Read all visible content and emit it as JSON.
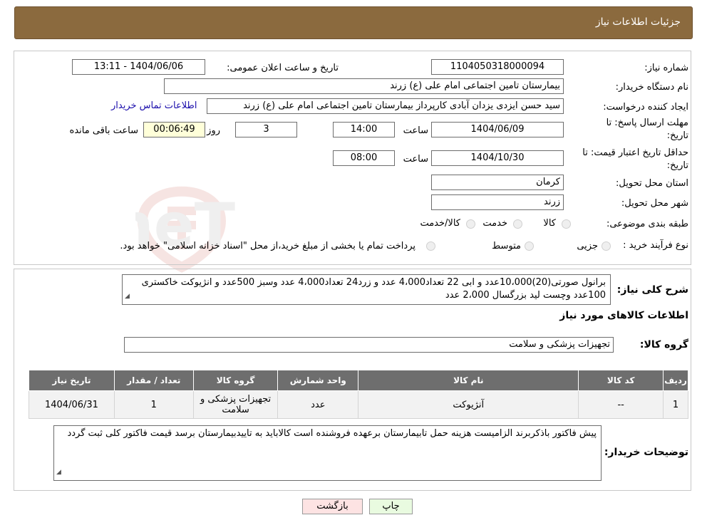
{
  "header": {
    "title": "جزئیات اطلاعات نیاز"
  },
  "form": {
    "need_number": {
      "label": "شماره نیاز:",
      "value": "1104050318000094"
    },
    "announce": {
      "label": "تاریخ و ساعت اعلان عمومی:",
      "value": "1404/06/06 - 13:11"
    },
    "buyer_org": {
      "label": "نام دستگاه خریدار:",
      "value": "بیمارستان تامین اجتماعی امام علی (ع) زرند"
    },
    "requester": {
      "label": "ایجاد کننده درخواست:",
      "value": "سید حسن ایزدی یزدان آبادی کارپرداز بیمارستان تامین اجتماعی امام علی (ع) زرند"
    },
    "buyer_contact_link": "اطلاعات تماس خریدار",
    "deadline": {
      "label_line1": "مهلت ارسال پاسخ: تا",
      "label_line2": "تاریخ:",
      "date": "1404/06/09",
      "time_label": "ساعت",
      "time": "14:00",
      "days": "3",
      "days_label": "روز و",
      "remaining": "00:06:49",
      "remaining_label": "ساعت باقی مانده"
    },
    "price_validity": {
      "label_line1": "حداقل تاریخ اعتبار قیمت: تا",
      "label_line2": "تاریخ:",
      "date": "1404/10/30",
      "time_label": "ساعت",
      "time": "08:00"
    },
    "province": {
      "label": "استان محل تحویل:",
      "value": "کرمان"
    },
    "city": {
      "label": "شهر محل تحویل:",
      "value": "زرند"
    },
    "category": {
      "label": "طبقه بندی موضوعی:",
      "options": [
        "کالا",
        "خدمت",
        "کالا/خدمت"
      ]
    },
    "purchase_type": {
      "label": "نوع فرآیند خرید :",
      "options": [
        "جزیی",
        "متوسط"
      ],
      "note": "پرداخت تمام یا بخشی از مبلغ خرید،از محل \"اسناد خزانه اسلامی\" خواهد بود."
    }
  },
  "description": {
    "label": "شرح کلی نیاز:",
    "text": "برانول صورتی(20)10،000عدد  و ابی 22 تعداد4،000 عدد  و زرد24 تعداد4،000 عدد  وسبز 500عدد  و انژیوکت خاکستری 100عدد  وچست لید بزرگسال 2،000 عدد"
  },
  "goods_info": {
    "title": "اطلاعات کالاهای مورد نیاز",
    "group_label": "گروه کالا:",
    "group_value": "تجهیزات پزشکی و سلامت"
  },
  "table": {
    "headers": [
      "ردیف",
      "کد کالا",
      "نام کالا",
      "واحد شمارش",
      "گروه کالا",
      "تعداد / مقدار",
      "تاریخ نیاز"
    ],
    "rows": [
      [
        "1",
        "--",
        "آنژیوکت",
        "عدد",
        "تجهیزات پزشکی و سلامت",
        "1",
        "1404/06/31"
      ]
    ]
  },
  "buyer_notes": {
    "label": "توضیحات خریدار:",
    "text": "پیش فاکتور باذکربرند الزامیست هزینه حمل تابیمارستان برعهده فروشنده است کالاباید به تاییدبیمارستان برسد       قیمت فاکتور کلی ثبت گردد"
  },
  "buttons": {
    "print": "چاپ",
    "back": "بازگشت"
  },
  "watermark": "AriaTender.neT",
  "colors": {
    "header_bg": "#8b6a3e",
    "table_header_bg": "#6e6e6e",
    "remaining_bg": "#ffffd9",
    "back_btn_bg": "#fde3e3",
    "print_btn_bg": "#e9fbe0"
  }
}
